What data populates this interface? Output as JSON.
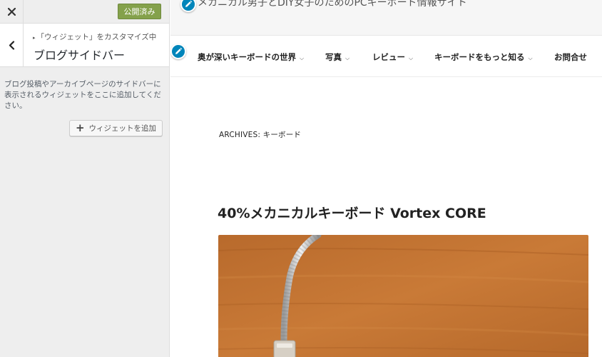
{
  "customizer": {
    "close_icon": "close-icon",
    "publish_label": "公開済み",
    "publish_color": "#84a14b",
    "back_icon": "chevron-left-icon",
    "breadcrumb": "「ウィジェット」をカスタマイズ中",
    "section_title": "ブログサイドバー",
    "description": "ブログ投稿やアーカイブページのサイドバーに表示されるウィジェットをここに追加してください。",
    "add_widget_label": "ウィジェットを追加"
  },
  "preview": {
    "tagline": "メカニカル男子とDIY女子のためのPCキーボード情報サイト",
    "edit_icon": "pencil-icon",
    "edit_color": "#0085ba",
    "nav": [
      {
        "label": "奥が深いキーボードの世界"
      },
      {
        "label": "写真"
      },
      {
        "label": "レビュー"
      },
      {
        "label": "キーボードをもっと知る"
      },
      {
        "label": "お問合せ"
      }
    ],
    "archive_label": "ARCHIVES: キーボード",
    "post_title": "40%メカニカルキーボード Vortex CORE"
  }
}
